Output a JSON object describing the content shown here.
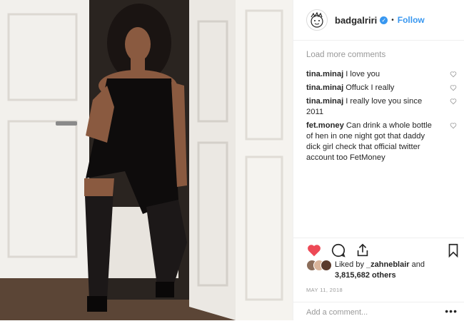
{
  "header": {
    "username": "badgalriri",
    "verified_mark": "✓",
    "separator": "•",
    "follow_label": "Follow"
  },
  "comments_section": {
    "load_more": "Load more comments",
    "items": [
      {
        "user": "tina.minaj",
        "text": "I love you"
      },
      {
        "user": "tina.minaj",
        "text": "Offuck I really"
      },
      {
        "user": "tina.minaj",
        "text": "I really love you since 2011"
      },
      {
        "user": "fet.money",
        "text": "Can drink a whole bottle of hen in one night got that daddy dick girl check that official twitter account too FetMoney"
      }
    ]
  },
  "actions": {
    "like_icon": "heart-filled-icon",
    "comment_icon": "comment-bubble-icon",
    "share_icon": "share-upload-icon",
    "save_icon": "bookmark-icon",
    "like_color": "#ed4956"
  },
  "likes": {
    "liked_by_prefix": "Liked by",
    "liked_by_user": "_zahneblair",
    "and_label": "and",
    "others_count": "3,815,682",
    "others_label": "others"
  },
  "post_date": "MAY 11, 2018",
  "add_comment": {
    "placeholder": "Add a comment...",
    "more_label": "•••"
  },
  "colors": {
    "accent": "#3897f0",
    "muted": "#999999",
    "text": "#262626"
  }
}
